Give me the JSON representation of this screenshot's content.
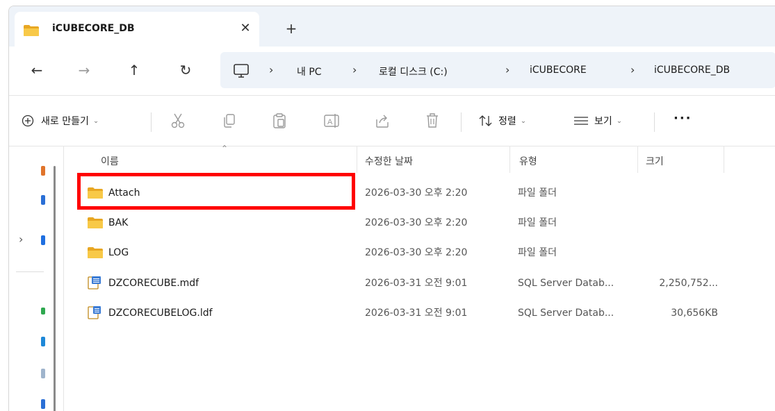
{
  "window": {
    "tab_title": "iCUBECORE_DB",
    "close_glyph": "✕",
    "newtab_glyph": "+"
  },
  "nav": {
    "back_glyph": "←",
    "forward_glyph": "→",
    "up_glyph": "↑",
    "refresh_glyph": "↻",
    "breadcrumbs": [
      "내 PC",
      "로컬 디스크 (C:)",
      "iCUBECORE",
      "iCUBECORE_DB"
    ],
    "separator": "›"
  },
  "toolbar": {
    "new_label": "새로 만들기",
    "sort_label": "정렬",
    "view_label": "보기",
    "more_label": "···",
    "icons": [
      "cut-icon",
      "copy-icon",
      "paste-icon",
      "rename-icon",
      "share-icon",
      "delete-icon"
    ]
  },
  "columns": {
    "name": "이름",
    "modified": "수정한 날짜",
    "type": "유형",
    "size": "크기"
  },
  "files": [
    {
      "name": "Attach",
      "modified": "2026-03-30 오후 2:20",
      "type": "파일 폴더",
      "size": "",
      "icon": "folder-icon"
    },
    {
      "name": "BAK",
      "modified": "2026-03-30 오후 2:20",
      "type": "파일 폴더",
      "size": "",
      "icon": "folder-icon"
    },
    {
      "name": "LOG",
      "modified": "2026-03-30 오후 2:20",
      "type": "파일 폴더",
      "size": "",
      "icon": "folder-icon"
    },
    {
      "name": "DZCORECUBE.mdf",
      "modified": "2026-03-31 오전 9:01",
      "type": "SQL Server Datab...",
      "size": "2,250,752...",
      "icon": "database-file-icon"
    },
    {
      "name": "DZCORECUBELOG.ldf",
      "modified": "2026-03-31 오전 9:01",
      "type": "SQL Server Datab...",
      "size": "30,656KB",
      "icon": "database-file-icon"
    }
  ],
  "colors": {
    "highlight": "#ff0000",
    "folder": "#f5c242",
    "chrome_bg": "#eef3f9"
  }
}
